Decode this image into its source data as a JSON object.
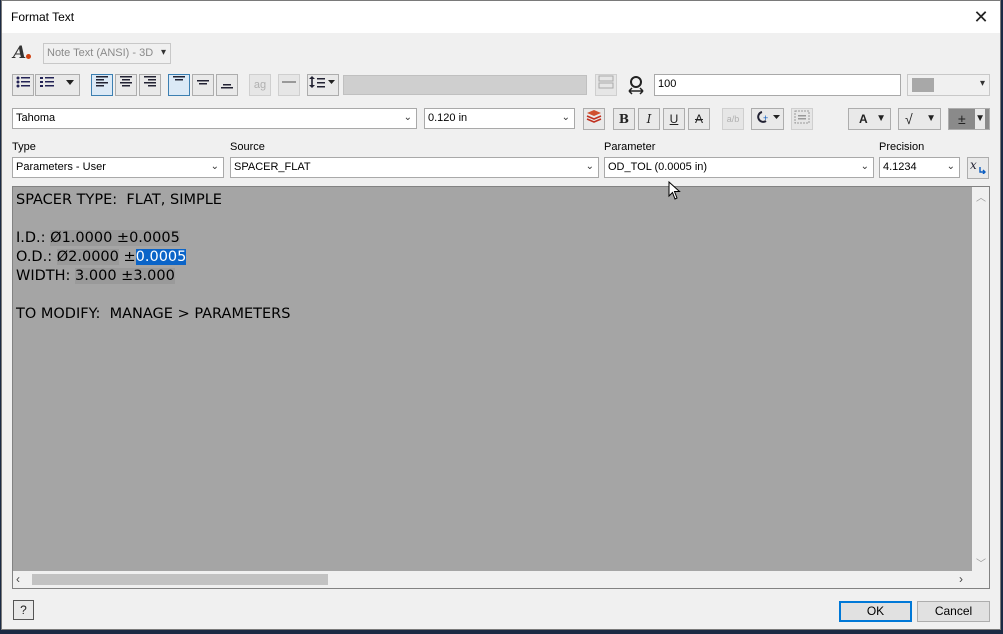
{
  "window": {
    "title": "Format Text",
    "close_glyph": "✕"
  },
  "style_combo": {
    "value": "Note Text (ANSI) - 3D",
    "icon": "text-style-icon"
  },
  "toolbar1": {
    "spacing_value": "100",
    "icons": [
      "bullet-list-icon",
      "numbered-list-icon",
      "align-left-icon",
      "align-center-icon",
      "align-right-icon",
      "align-top-icon",
      "align-middle-icon",
      "align-bottom-icon",
      "stack-text-icon",
      "line-icon",
      "line-spacing-icon",
      "stack-icon",
      "width-factor-icon",
      "color-swatch-icon"
    ]
  },
  "toolbar2": {
    "font": "Tahoma",
    "size": "0.120 in",
    "bold": "B",
    "italic": "I",
    "underline": "U",
    "strike": "A",
    "text_color_label": "A",
    "plusminus": "±",
    "sqrt": "√"
  },
  "params": {
    "type_label": "Type",
    "type_value": "Parameters - User",
    "source_label": "Source",
    "source_value": "SPACER_FLAT",
    "parameter_label": "Parameter",
    "parameter_value": "OD_TOL (0.0005 in)",
    "precision_label": "Precision",
    "precision_value": "4.1234"
  },
  "editor": {
    "line1": "SPACER TYPE:  FLAT, SIMPLE",
    "line2_prefix": "I.D.: ",
    "line2_a": "Ø1.0000",
    "line2_b": " ±0.0005",
    "line3_prefix": "O.D.: ",
    "line3_a": "Ø2.0000",
    "line3_b": " ±",
    "line3_sel": "0.0005",
    "line4_prefix": "WIDTH: ",
    "line4_a": "3.000",
    "line4_b": " ±3.000",
    "line5": "TO MODIFY:  MANAGE > PARAMETERS"
  },
  "footer": {
    "help": "?",
    "ok": "OK",
    "cancel": "Cancel"
  }
}
